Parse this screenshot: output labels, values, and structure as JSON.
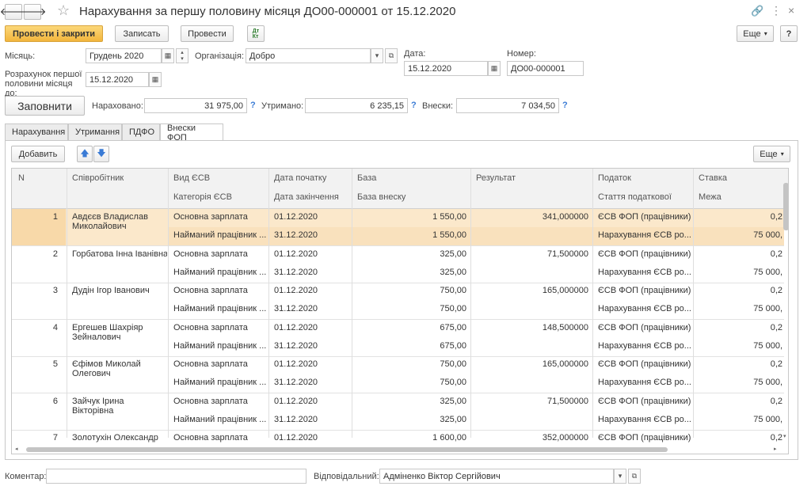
{
  "window": {
    "title": "Нарахування за першу половину місяця ДО00-000001 от 15.12.2020"
  },
  "toolbar": {
    "post_close": "Провести і закрити",
    "save": "Записать",
    "post": "Провести",
    "more": "Еще",
    "help": "?"
  },
  "form": {
    "month_label": "Місяць:",
    "month_value": "Грудень 2020",
    "org_label": "Організація:",
    "org_value": "Добро",
    "date_label": "Дата:",
    "date_value": "15.12.2020",
    "number_label": "Номер:",
    "number_value": "ДО00-000001",
    "calc_label": "Розрахунок першої половини місяця до:",
    "calc_value": "15.12.2020",
    "fill_button": "Заповнити",
    "accrued_label": "Нараховано:",
    "accrued_value": "31 975,00",
    "withheld_label": "Утримано:",
    "withheld_value": "6 235,15",
    "contrib_label": "Внески:",
    "contrib_value": "7 034,50",
    "q": "?"
  },
  "tabs": [
    "Нарахування",
    "Утримання",
    "ПДФО",
    "Внески ФОП"
  ],
  "table_toolbar": {
    "add": "Добавить",
    "more": "Еще"
  },
  "columns": {
    "n": "N",
    "employee": "Співробітник",
    "type": "Вид ЄСВ",
    "category": "Категорія ЄСВ",
    "date_start": "Дата початку",
    "date_end": "Дата закінчення",
    "base": "База",
    "base_contrib": "База внеску",
    "result": "Результат",
    "tax": "Податок",
    "tax_article": "Стаття податкової",
    "rate": "Ставка",
    "limit": "Межа"
  },
  "rows": [
    {
      "n": "1",
      "name1": "Авдєєв Владислав",
      "name2": "Миколайович",
      "type": "Основна зарплата",
      "category": "Найманий працівник ...",
      "date_start": "01.12.2020",
      "date_end": "31.12.2020",
      "base": "1 550,00",
      "base_contrib": "1 550,00",
      "result": "341,000000",
      "tax": "ЄСВ ФОП (працівники)",
      "tax_article": "Нарахування ЄСВ ро...",
      "rate": "0,2",
      "limit": "75 000,"
    },
    {
      "n": "2",
      "name1": "Горбатова Інна Іванівна",
      "name2": "",
      "type": "Основна зарплата",
      "category": "Найманий працівник ...",
      "date_start": "01.12.2020",
      "date_end": "31.12.2020",
      "base": "325,00",
      "base_contrib": "325,00",
      "result": "71,500000",
      "tax": "ЄСВ ФОП (працівники)",
      "tax_article": "Нарахування ЄСВ ро...",
      "rate": "0,2",
      "limit": "75 000,"
    },
    {
      "n": "3",
      "name1": "Дудін Ігор Іванович",
      "name2": "",
      "type": "Основна зарплата",
      "category": "Найманий працівник ...",
      "date_start": "01.12.2020",
      "date_end": "31.12.2020",
      "base": "750,00",
      "base_contrib": "750,00",
      "result": "165,000000",
      "tax": "ЄСВ ФОП (працівники)",
      "tax_article": "Нарахування ЄСВ ро...",
      "rate": "0,2",
      "limit": "75 000,"
    },
    {
      "n": "4",
      "name1": "Ергешев Шахріяр",
      "name2": "Зейналович",
      "type": "Основна зарплата",
      "category": "Найманий працівник ...",
      "date_start": "01.12.2020",
      "date_end": "31.12.2020",
      "base": "675,00",
      "base_contrib": "675,00",
      "result": "148,500000",
      "tax": "ЄСВ ФОП (працівники)",
      "tax_article": "Нарахування ЄСВ ро...",
      "rate": "0,2",
      "limit": "75 000,"
    },
    {
      "n": "5",
      "name1": "Єфімов Миколай",
      "name2": "Олегович",
      "type": "Основна зарплата",
      "category": "Найманий працівник ...",
      "date_start": "01.12.2020",
      "date_end": "31.12.2020",
      "base": "750,00",
      "base_contrib": "750,00",
      "result": "165,000000",
      "tax": "ЄСВ ФОП (працівники)",
      "tax_article": "Нарахування ЄСВ ро...",
      "rate": "0,2",
      "limit": "75 000,"
    },
    {
      "n": "6",
      "name1": "Зайчук Ірина",
      "name2": "Вікторівна",
      "type": "Основна зарплата",
      "category": "Найманий працівник ...",
      "date_start": "01.12.2020",
      "date_end": "31.12.2020",
      "base": "325,00",
      "base_contrib": "325,00",
      "result": "71,500000",
      "tax": "ЄСВ ФОП (працівники)",
      "tax_article": "Нарахування ЄСВ ро...",
      "rate": "0,2",
      "limit": "75 000,"
    },
    {
      "n": "7",
      "name1": "Золотухін Олександр",
      "name2": "",
      "type": "Основна зарплата",
      "category": "",
      "date_start": "01.12.2020",
      "date_end": "",
      "base": "1 600,00",
      "base_contrib": "",
      "result": "352,000000",
      "tax": "ЄСВ ФОП (працівники)",
      "tax_article": "",
      "rate": "0,2",
      "limit": ""
    }
  ],
  "footer": {
    "comment_label": "Коментар:",
    "comment_value": "",
    "responsible_label": "Відповідальний:",
    "responsible_value": "Адміненко Віктор Сергійович"
  },
  "icons": [
    "back-arrow-icon",
    "forward-arrow-icon",
    "star-icon",
    "link-icon",
    "kebab-icon",
    "close-icon",
    "calendar-icon",
    "dropdown-icon",
    "open-icon",
    "up-arrow-icon",
    "down-arrow-icon",
    "dt-kt-icon"
  ],
  "colors": {
    "primary": "#f2b53c",
    "selected_row": "#fbe8cb",
    "help": "#3a7bd5"
  }
}
